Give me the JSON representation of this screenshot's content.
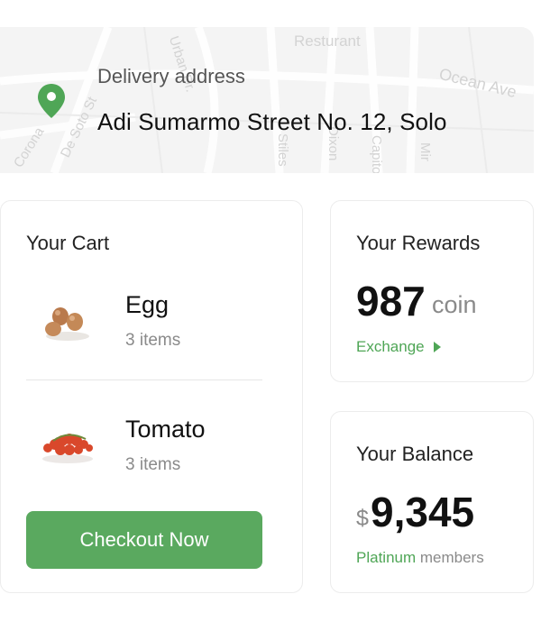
{
  "map": {
    "labels": [
      "Urban Dr.",
      "Resturant",
      "Ocean Ave",
      "De Soto St",
      "Corona",
      "Stiles",
      "Dixon",
      "Capitol",
      "Mir"
    ]
  },
  "delivery": {
    "caption": "Delivery address",
    "address": "Adi Sumarmo Street No. 12, Solo"
  },
  "cart": {
    "title": "Your Cart",
    "items": [
      {
        "name": "Egg",
        "qty": "3 items"
      },
      {
        "name": "Tomato",
        "qty": "3 items"
      }
    ],
    "checkout_label": "Checkout Now"
  },
  "rewards": {
    "title": "Your Rewards",
    "amount": "987",
    "unit": "coin",
    "action_label": "Exchange"
  },
  "balance": {
    "title": "Your Balance",
    "currency": "$",
    "amount": "9,345",
    "tier_name": "Platinum",
    "tier_suffix": "members"
  },
  "colors": {
    "accent": "#5aa95f",
    "accent_text": "#4fa656",
    "pin": "#4fa656"
  }
}
